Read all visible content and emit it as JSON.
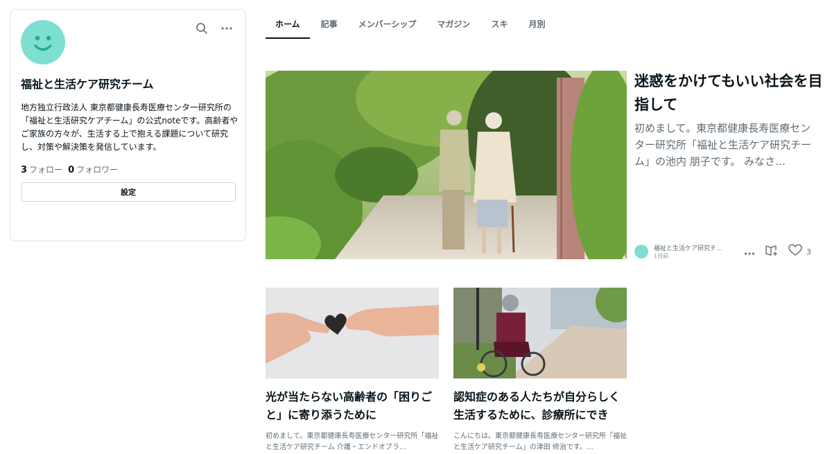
{
  "profile": {
    "name": "福祉と生活ケア研究チーム",
    "bio": "地方独立行政法人 東京都健康長寿医療センター研究所の「福祉と生活研究ケアチーム」の公式noteです。高齢者やご家族の方々が、生活する上で抱える課題について研究し、対策や解決策を発信しています。",
    "follow_count": "3",
    "follow_label": "フォロー",
    "follower_count": "0",
    "follower_label": "フォロワー",
    "settings_label": "設定",
    "icons": [
      "search-icon",
      "more-icon"
    ]
  },
  "tabs": [
    {
      "label": "ホーム",
      "active": true
    },
    {
      "label": "記事"
    },
    {
      "label": "メンバーシップ"
    },
    {
      "label": "マガジン"
    },
    {
      "label": "スキ"
    },
    {
      "label": "月別"
    }
  ],
  "featured": {
    "title": "迷惑をかけてもいい社会を目指して",
    "excerpt": "初めまして。東京都健康長寿医療センター研究所「福祉と生活ケア研究チーム」の池内 朋子です。 みなさ…",
    "author": "福祉と生活ケア研究チ…",
    "time": "1日前",
    "likes": "3"
  },
  "articles": [
    {
      "title": "光が当たらない高齢者の「困りごと」に寄り添うために",
      "excerpt": "初めまして。東京都健康長寿医療センター研究所「福祉と生活ケア研究チーム 介護・エンドオブラ…"
    },
    {
      "title": "認知症のある人たちが自分らしく生活するために、診療所にできる…",
      "excerpt": "こんにちは。東京都健康長寿医療センター研究所「福祉と生活ケア研究チーム」の津田 修治です。…"
    }
  ],
  "colors": {
    "accent": "#7ddfd0",
    "text": "#08131a",
    "muted": "#5e6b73"
  }
}
